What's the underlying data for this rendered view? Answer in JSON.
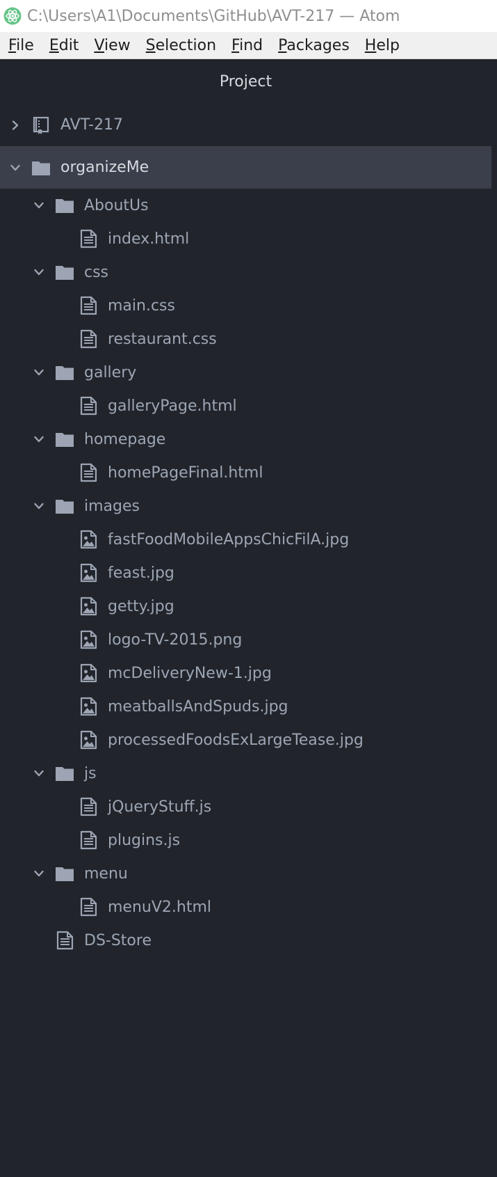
{
  "window": {
    "title": "C:\\Users\\A1\\Documents\\GitHub\\AVT-217 — Atom"
  },
  "menu": [
    {
      "key": "F",
      "rest": "ile"
    },
    {
      "key": "E",
      "rest": "dit"
    },
    {
      "key": "V",
      "rest": "iew"
    },
    {
      "key": "S",
      "rest": "election"
    },
    {
      "key": "F",
      "rest": "ind"
    },
    {
      "key": "P",
      "rest": "ackages"
    },
    {
      "key": "H",
      "rest": "elp"
    }
  ],
  "panel": {
    "title": "Project"
  },
  "tree": [
    {
      "label": "AVT-217",
      "depth": 0,
      "kind": "repo",
      "expanded": false,
      "root": true
    },
    {
      "label": "organizeMe",
      "depth": 0,
      "kind": "folder",
      "expanded": true,
      "root": true,
      "selected": true
    },
    {
      "label": "AboutUs",
      "depth": 1,
      "kind": "folder",
      "expanded": true
    },
    {
      "label": "index.html",
      "depth": 2,
      "kind": "file"
    },
    {
      "label": "css",
      "depth": 1,
      "kind": "folder",
      "expanded": true
    },
    {
      "label": "main.css",
      "depth": 2,
      "kind": "file"
    },
    {
      "label": "restaurant.css",
      "depth": 2,
      "kind": "file"
    },
    {
      "label": "gallery",
      "depth": 1,
      "kind": "folder",
      "expanded": true
    },
    {
      "label": "galleryPage.html",
      "depth": 2,
      "kind": "file"
    },
    {
      "label": "homepage",
      "depth": 1,
      "kind": "folder",
      "expanded": true
    },
    {
      "label": "homePageFinal.html",
      "depth": 2,
      "kind": "file"
    },
    {
      "label": "images",
      "depth": 1,
      "kind": "folder",
      "expanded": true
    },
    {
      "label": "fastFoodMobileAppsChicFilA.jpg",
      "depth": 2,
      "kind": "image"
    },
    {
      "label": "feast.jpg",
      "depth": 2,
      "kind": "image"
    },
    {
      "label": "getty.jpg",
      "depth": 2,
      "kind": "image"
    },
    {
      "label": "logo-TV-2015.png",
      "depth": 2,
      "kind": "image"
    },
    {
      "label": "mcDeliveryNew-1.jpg",
      "depth": 2,
      "kind": "image"
    },
    {
      "label": "meatballsAndSpuds.jpg",
      "depth": 2,
      "kind": "image"
    },
    {
      "label": "processedFoodsExLargeTease.jpg",
      "depth": 2,
      "kind": "image"
    },
    {
      "label": "js",
      "depth": 1,
      "kind": "folder",
      "expanded": true
    },
    {
      "label": "jQueryStuff.js",
      "depth": 2,
      "kind": "file"
    },
    {
      "label": "plugins.js",
      "depth": 2,
      "kind": "file"
    },
    {
      "label": "menu",
      "depth": 1,
      "kind": "folder",
      "expanded": true
    },
    {
      "label": "menuV2.html",
      "depth": 2,
      "kind": "file"
    },
    {
      "label": "DS-Store",
      "depth": 1,
      "kind": "file"
    }
  ],
  "colors": {
    "tree_text": "#9da5b4",
    "selected_text": "#d7dae0",
    "icon": "#9da5b4",
    "selected_bg": "#3a3f4b",
    "panel_bg": "#21252b",
    "atom_green": "#66c58a"
  }
}
